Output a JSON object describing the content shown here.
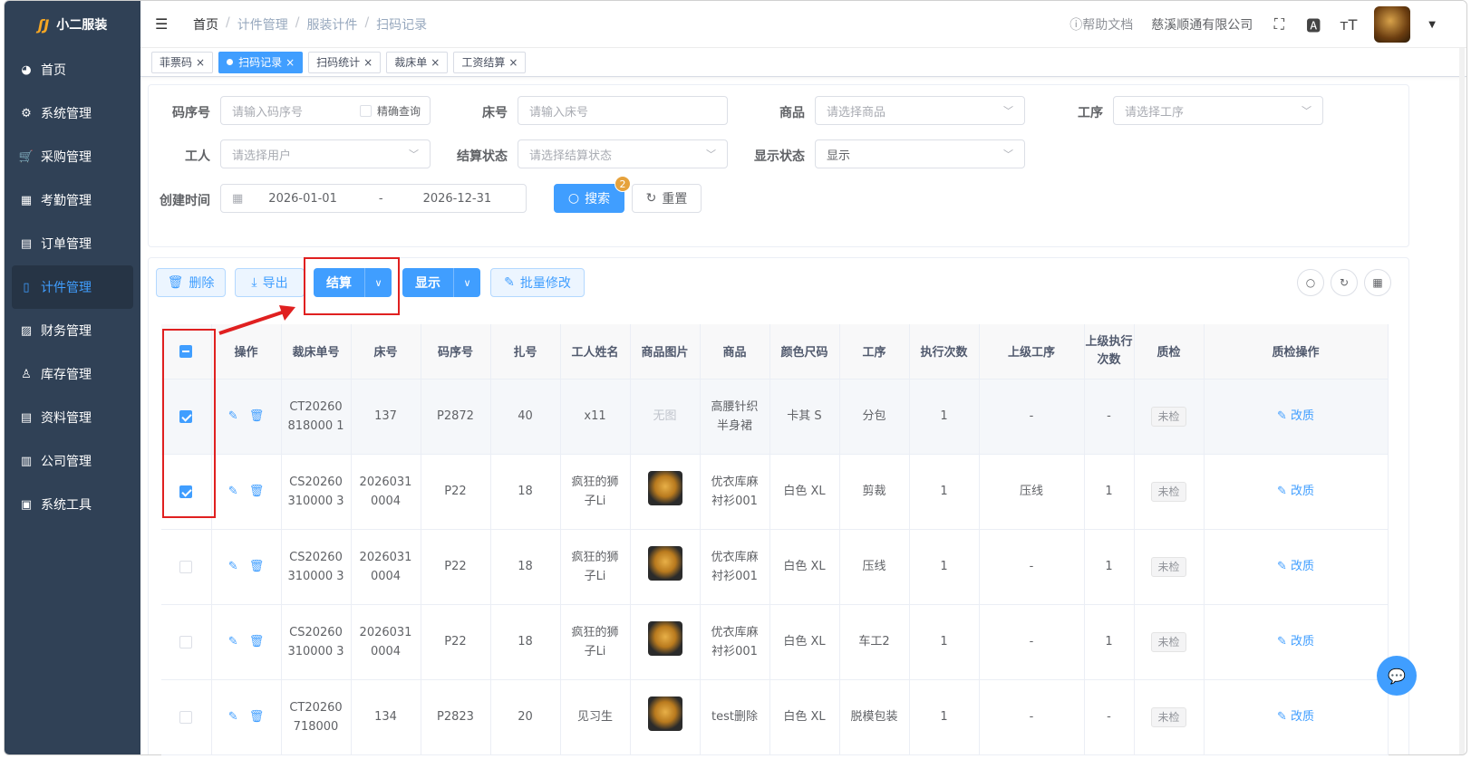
{
  "app": {
    "logo_mark": "ʃJ",
    "name": "小二服装"
  },
  "sidebar": {
    "items": [
      {
        "label": "首页",
        "icon": "dashboard-icon",
        "glyph": "◕"
      },
      {
        "label": "系统管理",
        "icon": "gear-icon",
        "glyph": "⚙"
      },
      {
        "label": "采购管理",
        "icon": "cart-icon",
        "glyph": "🛒"
      },
      {
        "label": "考勤管理",
        "icon": "grid-icon",
        "glyph": "▦"
      },
      {
        "label": "订单管理",
        "icon": "order-icon",
        "glyph": "▤"
      },
      {
        "label": "计件管理",
        "icon": "book-icon",
        "glyph": "▯"
      },
      {
        "label": "财务管理",
        "icon": "chart-icon",
        "glyph": "▨"
      },
      {
        "label": "库存管理",
        "icon": "user-icon",
        "glyph": "♙"
      },
      {
        "label": "资料管理",
        "icon": "document-icon",
        "glyph": "▤"
      },
      {
        "label": "公司管理",
        "icon": "bar-chart-icon",
        "glyph": "▥"
      },
      {
        "label": "系统工具",
        "icon": "toolbox-icon",
        "glyph": "▣"
      }
    ],
    "active_index": 5
  },
  "header": {
    "breadcrumb": [
      "首页",
      "计件管理",
      "服装计件",
      "扫码记录"
    ],
    "help": "帮助文档",
    "company": "慈溪顺通有限公司"
  },
  "tabs": [
    {
      "label": "菲票码",
      "active": false
    },
    {
      "label": "扫码记录",
      "active": true
    },
    {
      "label": "扫码统计",
      "active": false
    },
    {
      "label": "裁床单",
      "active": false
    },
    {
      "label": "工资结算",
      "active": false
    }
  ],
  "search": {
    "code_label": "码序号",
    "code_placeholder": "请输入码序号",
    "exact_label": "精确查询",
    "bed_label": "床号",
    "bed_placeholder": "请输入床号",
    "product_label": "商品",
    "product_placeholder": "请选择商品",
    "process_label": "工序",
    "process_placeholder": "请选择工序",
    "worker_label": "工人",
    "worker_placeholder": "请选择用户",
    "settle_label": "结算状态",
    "settle_placeholder": "请选择结算状态",
    "display_label": "显示状态",
    "display_value": "显示",
    "created_label": "创建时间",
    "date_from": "2026-01-01",
    "date_sep": "-",
    "date_to": "2026-12-31",
    "search_btn": "搜索",
    "search_badge": "2",
    "reset_btn": "重置"
  },
  "toolbar": {
    "delete": "删除",
    "export": "导出",
    "settle": "结算",
    "display": "显示",
    "batch_edit": "批量修改"
  },
  "table": {
    "headers": [
      "操作",
      "裁床单号",
      "床号",
      "码序号",
      "扎号",
      "工人姓名",
      "商品图片",
      "商品",
      "颜色尺码",
      "工序",
      "执行次数",
      "上级工序",
      "上级执行次数",
      "质检",
      "质检操作"
    ],
    "rows": [
      {
        "checked": true,
        "cut_no": "CT20260818000 1",
        "bed": "137",
        "code": "P2872",
        "bundle": "40",
        "worker": "x11",
        "img": "无图",
        "has_img": false,
        "product": "高腰针织半身裙",
        "color_size": "卡其 S",
        "process": "分包",
        "runs": "1",
        "parent": "-",
        "parent_runs": "-",
        "qc": "未检",
        "qc_op": "改质"
      },
      {
        "checked": true,
        "cut_no": "CS20260310000 3",
        "bed": "20260310004",
        "code": "P22",
        "bundle": "18",
        "worker": "疯狂的狮子Li",
        "img": "",
        "has_img": true,
        "product": "优衣库麻衬衫001",
        "color_size": "白色 XL",
        "process": "剪裁",
        "runs": "1",
        "parent": "压线",
        "parent_runs": "1",
        "qc": "未检",
        "qc_op": "改质"
      },
      {
        "checked": false,
        "cut_no": "CS20260310000 3",
        "bed": "20260310004",
        "code": "P22",
        "bundle": "18",
        "worker": "疯狂的狮子Li",
        "img": "",
        "has_img": true,
        "product": "优衣库麻衬衫001",
        "color_size": "白色 XL",
        "process": "压线",
        "runs": "1",
        "parent": "-",
        "parent_runs": "1",
        "qc": "未检",
        "qc_op": "改质"
      },
      {
        "checked": false,
        "cut_no": "CS20260310000 3",
        "bed": "20260310004",
        "code": "P22",
        "bundle": "18",
        "worker": "疯狂的狮子Li",
        "img": "",
        "has_img": true,
        "product": "优衣库麻衬衫001",
        "color_size": "白色 XL",
        "process": "车工2",
        "runs": "1",
        "parent": "-",
        "parent_runs": "1",
        "qc": "未检",
        "qc_op": "改质"
      },
      {
        "checked": false,
        "cut_no": "CT20260718000",
        "bed": "134",
        "code": "P2823",
        "bundle": "20",
        "worker": "见习生",
        "img": "",
        "has_img": true,
        "product": "test删除",
        "color_size": "白色 XL",
        "process": "脱模包装",
        "runs": "1",
        "parent": "-",
        "parent_runs": "-",
        "qc": "未检",
        "qc_op": "改质"
      }
    ]
  },
  "colors": {
    "primary": "#409eff",
    "sidebar_bg": "#304156",
    "highlight": "#e02020"
  }
}
